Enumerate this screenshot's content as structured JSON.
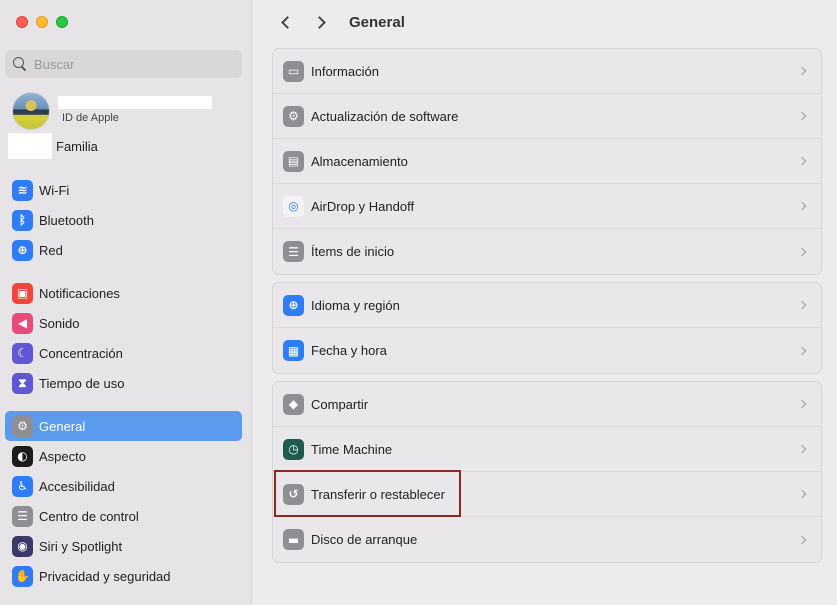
{
  "window": {
    "title": "General"
  },
  "sidebar": {
    "search_placeholder": "Buscar",
    "account_subtitle": "ID de Apple",
    "family_label": "Familia",
    "groups": [
      [
        {
          "label": "Wi-Fi",
          "icon": "wifi-icon",
          "color": "#2f7cf6",
          "glyph": "≋"
        },
        {
          "label": "Bluetooth",
          "icon": "bluetooth-icon",
          "color": "#2f7cf6",
          "glyph": "ᛒ"
        },
        {
          "label": "Red",
          "icon": "globe-icon",
          "color": "#2f7cf6",
          "glyph": "⊕"
        }
      ],
      [
        {
          "label": "Notificaciones",
          "icon": "bell-icon",
          "color": "#f0453a",
          "glyph": "▣"
        },
        {
          "label": "Sonido",
          "icon": "speaker-icon",
          "color": "#e84a7a",
          "glyph": "◀"
        },
        {
          "label": "Concentración",
          "icon": "moon-icon",
          "color": "#6157d6",
          "glyph": "☾"
        },
        {
          "label": "Tiempo de uso",
          "icon": "hourglass-icon",
          "color": "#6157d6",
          "glyph": "⧗"
        }
      ],
      [
        {
          "label": "General",
          "icon": "gear-icon",
          "color": "#8e8e93",
          "glyph": "⚙",
          "active": true
        },
        {
          "label": "Aspecto",
          "icon": "appearance-icon",
          "color": "#1c1c1e",
          "glyph": "◐"
        },
        {
          "label": "Accesibilidad",
          "icon": "accessibility-icon",
          "color": "#2f7cf6",
          "glyph": "♿"
        },
        {
          "label": "Centro de control",
          "icon": "control-center-icon",
          "color": "#8e8e93",
          "glyph": "☰"
        },
        {
          "label": "Siri y Spotlight",
          "icon": "siri-icon",
          "color": "#3a3a6a",
          "glyph": "◉"
        },
        {
          "label": "Privacidad y seguridad",
          "icon": "hand-icon",
          "color": "#2f7cf6",
          "glyph": "✋"
        }
      ]
    ]
  },
  "main": {
    "title": "General",
    "groups": [
      [
        {
          "label": "Información",
          "icon": "info-icon",
          "color": "#8e8e93",
          "glyph": "▭"
        },
        {
          "label": "Actualización de software",
          "icon": "software-update-icon",
          "color": "#8e8e93",
          "glyph": "⚙"
        },
        {
          "label": "Almacenamiento",
          "icon": "storage-icon",
          "color": "#8e8e93",
          "glyph": "▤"
        },
        {
          "label": "AirDrop y Handoff",
          "icon": "airdrop-icon",
          "color": "#f3f3f5",
          "glyph": "◎",
          "dark_glyph": true
        },
        {
          "label": "Ítems de inicio",
          "icon": "list-icon",
          "color": "#8e8e93",
          "glyph": "☰"
        }
      ],
      [
        {
          "label": "Idioma y región",
          "icon": "globe-icon",
          "color": "#2f7cf6",
          "glyph": "⊕"
        },
        {
          "label": "Fecha y hora",
          "icon": "calendar-clock-icon",
          "color": "#2f7cf6",
          "glyph": "▦"
        }
      ],
      [
        {
          "label": "Compartir",
          "icon": "share-icon",
          "color": "#8e8e93",
          "glyph": "◆"
        },
        {
          "label": "Time Machine",
          "icon": "time-machine-icon",
          "color": "#1f5a4f",
          "glyph": "◷"
        },
        {
          "label": "Transferir o restablecer",
          "icon": "reset-icon",
          "color": "#8e8e93",
          "glyph": "↺"
        },
        {
          "label": "Disco de arranque",
          "icon": "startup-disk-icon",
          "color": "#8e8e93",
          "glyph": "▬"
        }
      ]
    ]
  }
}
